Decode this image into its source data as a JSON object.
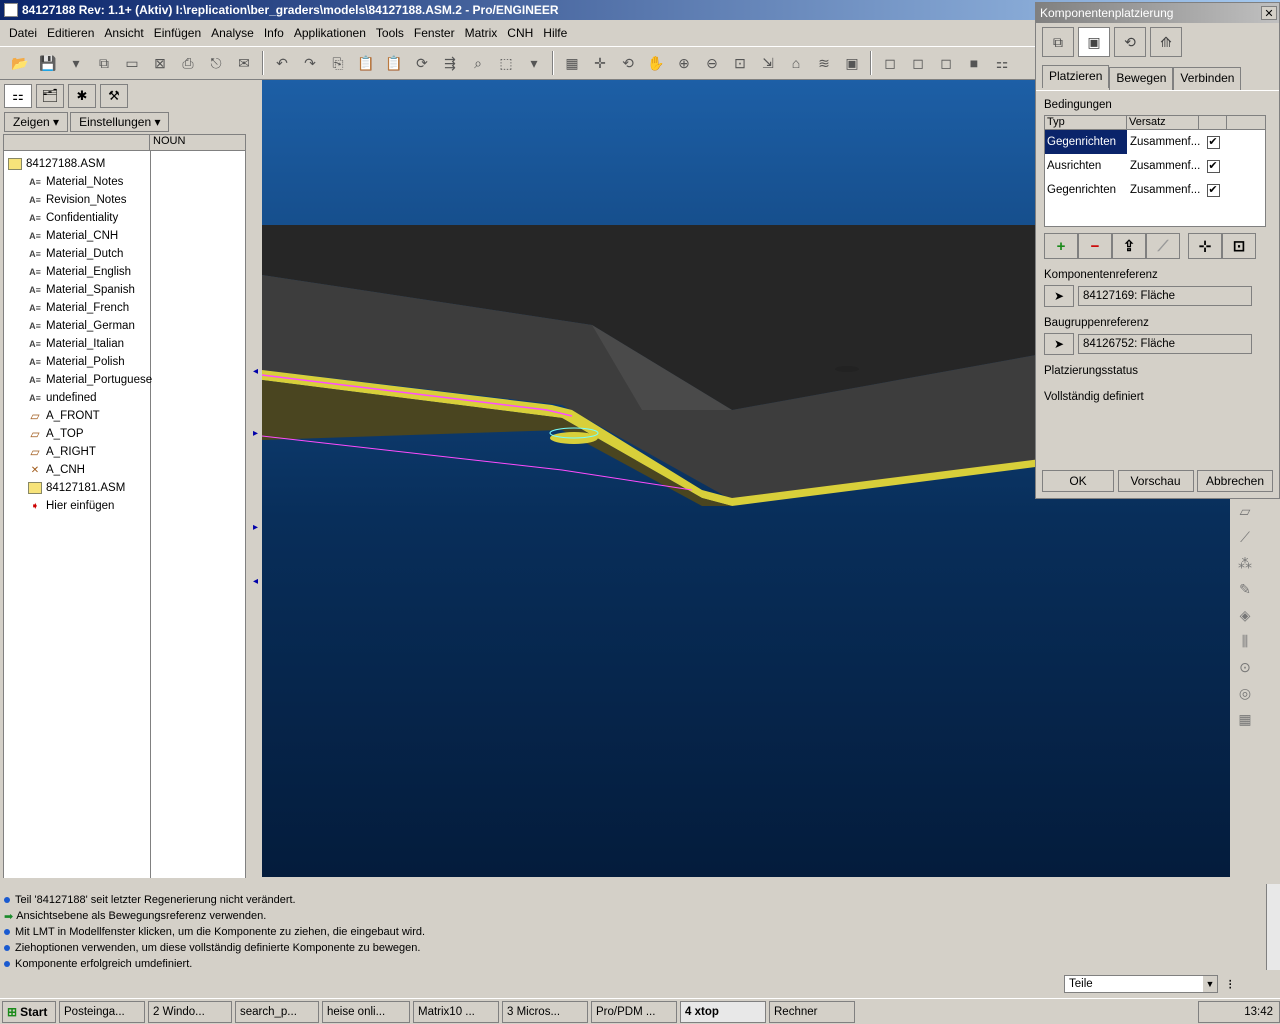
{
  "window": {
    "title": "84127188 Rev: 1.1+ (Aktiv) I:\\replication\\ber_graders\\models\\84127188.ASM.2 - Pro/ENGINEER"
  },
  "menu": [
    "Datei",
    "Editieren",
    "Ansicht",
    "Einfügen",
    "Analyse",
    "Info",
    "Applikationen",
    "Tools",
    "Fenster",
    "Matrix",
    "CNH",
    "Hilfe"
  ],
  "left_panel": {
    "show_label": "Zeigen",
    "settings_label": "Einstellungen",
    "column2_header": "NOUN",
    "tree": [
      {
        "label": "84127188.ASM",
        "icon": "assembly-icon"
      },
      {
        "label": "Material_Notes",
        "icon": "note-icon"
      },
      {
        "label": "Revision_Notes",
        "icon": "note-icon"
      },
      {
        "label": "Confidentiality",
        "icon": "note-icon"
      },
      {
        "label": "Material_CNH",
        "icon": "note-icon"
      },
      {
        "label": "Material_Dutch",
        "icon": "note-icon"
      },
      {
        "label": "Material_English",
        "icon": "note-icon"
      },
      {
        "label": "Material_Spanish",
        "icon": "note-icon"
      },
      {
        "label": "Material_French",
        "icon": "note-icon"
      },
      {
        "label": "Material_German",
        "icon": "note-icon"
      },
      {
        "label": "Material_Italian",
        "icon": "note-icon"
      },
      {
        "label": "Material_Polish",
        "icon": "note-icon"
      },
      {
        "label": "Material_Portuguese",
        "icon": "note-icon"
      },
      {
        "label": "undefined",
        "icon": "note-icon"
      },
      {
        "label": "A_FRONT",
        "icon": "datum-plane-icon"
      },
      {
        "label": "A_TOP",
        "icon": "datum-plane-icon"
      },
      {
        "label": "A_RIGHT",
        "icon": "datum-plane-icon"
      },
      {
        "label": "A_CNH",
        "icon": "csys-icon"
      },
      {
        "label": "84127181.ASM",
        "icon": "assembly-icon"
      },
      {
        "label": "Hier einfügen",
        "icon": "insert-arrow-icon"
      }
    ]
  },
  "dialog": {
    "title": "Komponentenplatzierung",
    "tabs": [
      "Platzieren",
      "Bewegen",
      "Verbinden"
    ],
    "constraints_label": "Bedingungen",
    "col_type": "Typ",
    "col_offset": "Versatz",
    "rows": [
      {
        "type": "Gegenrichten",
        "offset": "Zusammenf...",
        "checked": "✔"
      },
      {
        "type": "Ausrichten",
        "offset": "Zusammenf...",
        "checked": "✔"
      },
      {
        "type": "Gegenrichten",
        "offset": "Zusammenf...",
        "checked": "✔"
      }
    ],
    "comp_ref_label": "Komponentenreferenz",
    "comp_ref_value": "84127169: Fläche",
    "asm_ref_label": "Baugruppenreferenz",
    "asm_ref_value": "84126752: Fläche",
    "status_label": "Platzierungsstatus",
    "status_value": "Vollständig definiert",
    "ok": "OK",
    "preview": "Vorschau",
    "cancel": "Abbrechen"
  },
  "messages": [
    "Teil '84127188' seit letzter Regenerierung nicht verändert.",
    "Ansichtsebene als Bewegungsreferenz verwenden.",
    "Mit LMT in Modellfenster klicken, um die Komponente zu ziehen, die eingebaut wird.",
    "Ziehoptionen verwenden, um diese vollständig definierte Komponente zu bewegen.",
    "Komponente erfolgreich umdefiniert."
  ],
  "filter": {
    "value": "Teile"
  },
  "taskbar": {
    "start": "Start",
    "tasks": [
      "Posteinga...",
      "2 Windo...",
      "search_p...",
      "heise onli...",
      "Matrix10 ...",
      "3 Micros...",
      "Pro/PDM ...",
      "4 xtop",
      "Rechner"
    ],
    "clock": "13:42"
  }
}
